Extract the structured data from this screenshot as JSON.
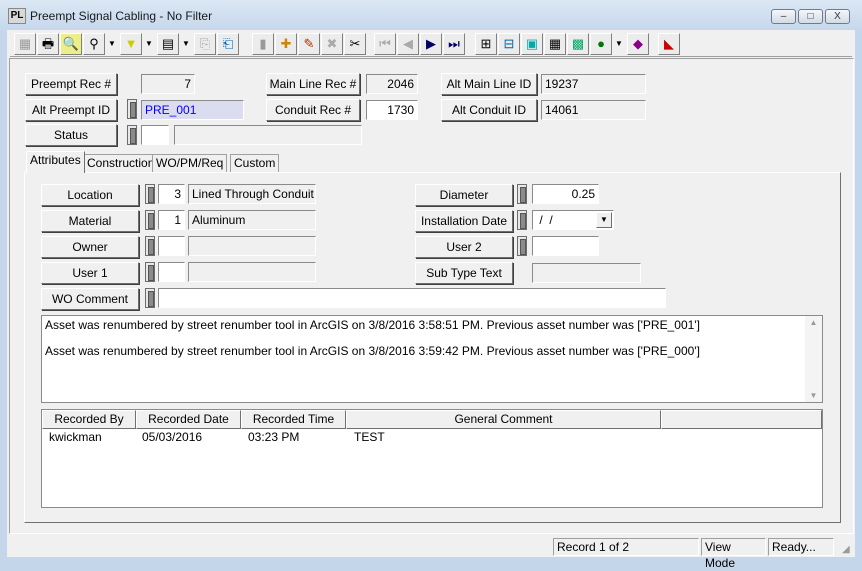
{
  "window": {
    "title": "Preempt Signal Cabling - No Filter",
    "icon_text": "PL",
    "minimize": "–",
    "maximize": "□",
    "close": "X"
  },
  "toolbar": {
    "icons": [
      "grid-icon",
      "print-icon",
      "print-preview-icon",
      "query-icon",
      "filter-icon",
      "report-icon",
      "copy-icon",
      "paste-icon",
      "save-icon",
      "add-icon",
      "edit-icon",
      "delete-icon",
      "cut-icon",
      "first-record-icon",
      "previous-record-icon",
      "next-record-icon",
      "last-record-icon",
      "hierarchy-icon",
      "relationship-icon",
      "map-icon",
      "calculator-icon",
      "chart-icon",
      "globe-icon",
      "book-icon",
      "exit-icon"
    ]
  },
  "header": {
    "preempt_rec": {
      "label": "Preempt Rec #",
      "value": "7"
    },
    "alt_preempt_id": {
      "label": "Alt Preempt ID",
      "value": "PRE_001"
    },
    "status": {
      "label": "Status",
      "code": "",
      "desc": ""
    },
    "main_line_rec": {
      "label": "Main Line Rec #",
      "value": "2046"
    },
    "conduit_rec": {
      "label": "Conduit Rec #",
      "value": "1730"
    },
    "alt_main_line_id": {
      "label": "Alt Main Line ID",
      "value": "19237"
    },
    "alt_conduit_id": {
      "label": "Alt Conduit ID",
      "value": "14061"
    }
  },
  "tabs": [
    "Attributes",
    "Construction",
    "WO/PM/Req",
    "Custom"
  ],
  "attributes": {
    "location": {
      "label": "Location",
      "code": "3",
      "desc": "Lined Through Conduit"
    },
    "material": {
      "label": "Material",
      "code": "1",
      "desc": "Aluminum"
    },
    "owner": {
      "label": "Owner",
      "code": "",
      "desc": ""
    },
    "user1": {
      "label": "User 1",
      "code": "",
      "desc": ""
    },
    "wo_comment": {
      "label": "WO Comment",
      "value": ""
    },
    "diameter": {
      "label": "Diameter",
      "value": "0.25"
    },
    "installation_date": {
      "label": "Installation Date",
      "value": " /  /"
    },
    "user2": {
      "label": "User 2",
      "value": ""
    },
    "sub_type_text": {
      "label": "Sub Type Text",
      "value": ""
    }
  },
  "memo": [
    "Asset was renumbered by street renumber tool in ArcGIS on 3/8/2016 3:58:51 PM.  Previous asset number was ['PRE_001']",
    "Asset was renumbered by street renumber tool in ArcGIS on 3/8/2016 3:59:42 PM.  Previous asset number was ['PRE_000']"
  ],
  "comments": {
    "columns": [
      "Recorded By",
      "Recorded Date",
      "Recorded Time",
      "General Comment",
      ""
    ],
    "rows": [
      [
        "kwickman",
        "05/03/2016",
        "03:23 PM",
        "TEST"
      ]
    ]
  },
  "statusbar": {
    "record": "Record 1 of 2",
    "mode": "View Mode",
    "state": "Ready..."
  }
}
